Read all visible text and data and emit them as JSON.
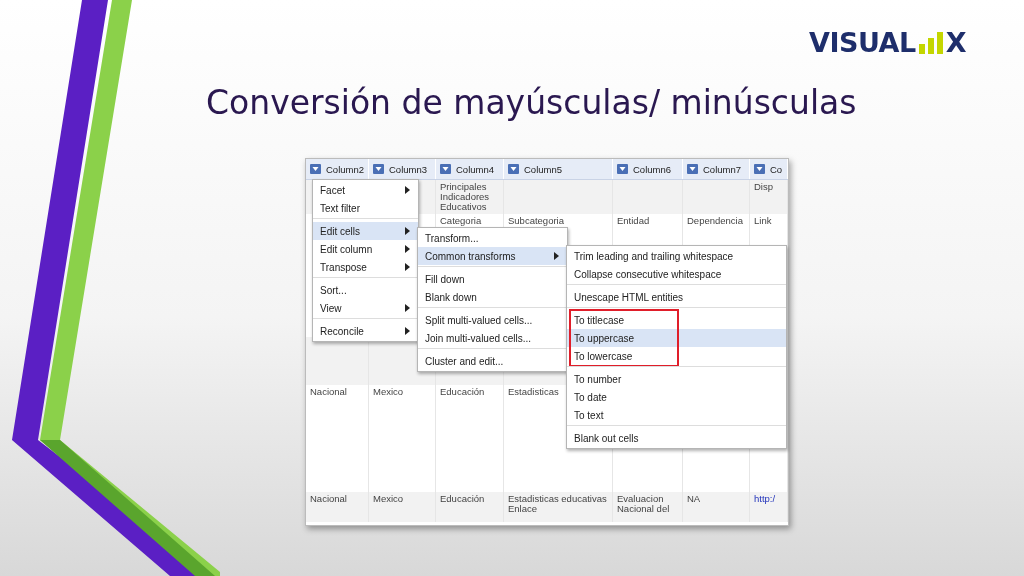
{
  "logo": {
    "word": "VISUAL",
    "letter": "X"
  },
  "title": "Conversión de mayúsculas/ minúsculas",
  "table": {
    "columns": [
      "Column2",
      "Column3",
      "Column4",
      "Column5",
      "Column6",
      "Column7",
      "Co"
    ],
    "rows": [
      [
        null,
        null,
        "Principales Indicadores Educativos",
        null,
        null,
        null,
        "Disp"
      ],
      [
        null,
        null,
        "Categoria",
        "Subcategoria",
        "Entidad",
        "Dependencia",
        "Link"
      ],
      [
        null,
        null,
        null,
        null,
        null,
        null,
        null
      ],
      [
        "Nacional",
        "Mexico",
        "Educación",
        "Estadisticas",
        null,
        null,
        null
      ],
      [
        "Nacional",
        "Mexico",
        "Educación",
        "Estadisticas educativas Enlace",
        "Evaluacion Nacional del",
        "NA",
        "http:/"
      ]
    ]
  },
  "menus": [
    {
      "groups": [
        {
          "items": [
            {
              "label": "Facet",
              "submenu": true,
              "highlighted": false
            },
            {
              "label": "Text filter",
              "submenu": false,
              "highlighted": false
            }
          ]
        },
        {
          "items": [
            {
              "label": "Edit cells",
              "submenu": true,
              "highlighted": true
            },
            {
              "label": "Edit column",
              "submenu": true,
              "highlighted": false
            },
            {
              "label": "Transpose",
              "submenu": true,
              "highlighted": false
            }
          ]
        },
        {
          "items": [
            {
              "label": "Sort...",
              "submenu": false,
              "highlighted": false
            },
            {
              "label": "View",
              "submenu": true,
              "highlighted": false
            }
          ]
        },
        {
          "items": [
            {
              "label": "Reconcile",
              "submenu": true,
              "highlighted": false
            }
          ]
        }
      ]
    },
    {
      "groups": [
        {
          "items": [
            {
              "label": "Transform...",
              "submenu": false,
              "highlighted": false
            },
            {
              "label": "Common transforms",
              "submenu": true,
              "highlighted": true
            }
          ]
        },
        {
          "items": [
            {
              "label": "Fill down",
              "submenu": false,
              "highlighted": false
            },
            {
              "label": "Blank down",
              "submenu": false,
              "highlighted": false
            }
          ]
        },
        {
          "items": [
            {
              "label": "Split multi-valued cells...",
              "submenu": false,
              "highlighted": false
            },
            {
              "label": "Join multi-valued cells...",
              "submenu": false,
              "highlighted": false
            }
          ]
        },
        {
          "items": [
            {
              "label": "Cluster and edit...",
              "submenu": false,
              "highlighted": false
            }
          ]
        }
      ]
    },
    {
      "groups": [
        {
          "items": [
            {
              "label": "Trim leading and trailing whitespace",
              "submenu": false,
              "highlighted": false
            },
            {
              "label": "Collapse consecutive whitespace",
              "submenu": false,
              "highlighted": false
            }
          ]
        },
        {
          "items": [
            {
              "label": "Unescape HTML entities",
              "submenu": false,
              "highlighted": false
            }
          ]
        },
        {
          "outlined": true,
          "items": [
            {
              "label": "To titlecase",
              "submenu": false,
              "highlighted": false
            },
            {
              "label": "To uppercase",
              "submenu": false,
              "highlighted": true
            },
            {
              "label": "To lowercase",
              "submenu": false,
              "highlighted": false
            }
          ]
        },
        {
          "items": [
            {
              "label": "To number",
              "submenu": false,
              "highlighted": false
            },
            {
              "label": "To date",
              "submenu": false,
              "highlighted": false
            },
            {
              "label": "To text",
              "submenu": false,
              "highlighted": false
            }
          ]
        },
        {
          "items": [
            {
              "label": "Blank out cells",
              "submenu": false,
              "highlighted": false
            }
          ]
        }
      ]
    }
  ]
}
